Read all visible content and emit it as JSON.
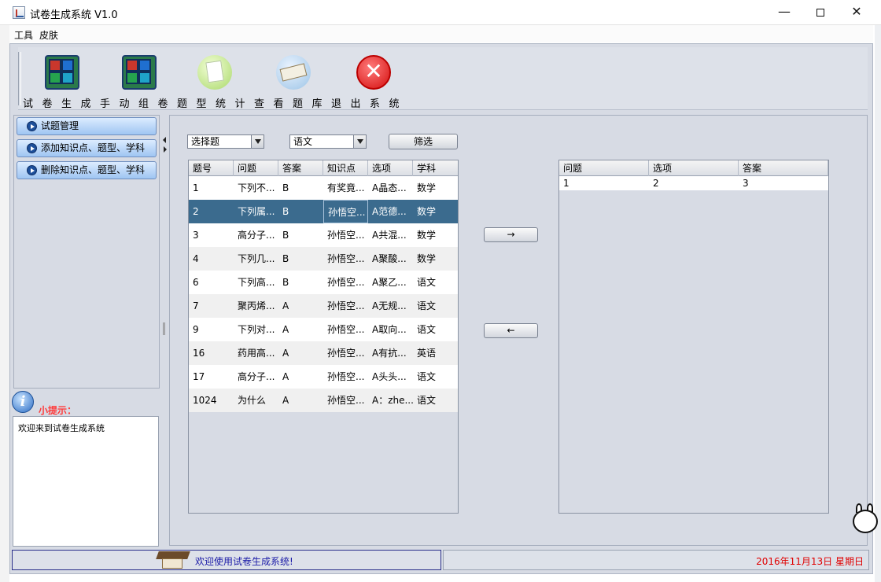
{
  "window": {
    "title": "试卷生成系统 V1.0",
    "minimize": "—",
    "close": "✕"
  },
  "menu": [
    "工具",
    "皮肤"
  ],
  "toolbar": {
    "labels": "试卷生成手动组卷题型统计查看题库退出系统",
    "buttons": [
      {
        "label": "试卷生成",
        "icon": "grid-icon"
      },
      {
        "label": "手动组卷",
        "icon": "grid-icon"
      },
      {
        "label": "题型统计",
        "icon": "note-icon"
      },
      {
        "label": "查看题库",
        "icon": "book-icon"
      },
      {
        "label": "退出系统",
        "icon": "exit-icon"
      }
    ]
  },
  "sidebar": {
    "items": [
      "试题管理",
      "添加知识点、题型、学科",
      "删除知识点、题型、学科"
    ]
  },
  "tip": {
    "title": "小提示：",
    "text": "欢迎来到试卷生成系统"
  },
  "filters": {
    "type_value": "选择题",
    "subject_value": "语文",
    "filter_button": "筛选"
  },
  "question_table": {
    "columns": [
      "题号",
      "问题",
      "答案",
      "知识点",
      "选项",
      "学科"
    ],
    "rows": [
      [
        "1",
        "下列不...",
        "B",
        "有奖竟...",
        "A晶态...",
        "数学"
      ],
      [
        "2",
        "下列属...",
        "B",
        "孙悟空...",
        "A范德...",
        "数学"
      ],
      [
        "3",
        "高分子...",
        "B",
        "孙悟空...",
        "A共混...",
        "数学"
      ],
      [
        "4",
        "下列几...",
        "B",
        "孙悟空...",
        "A聚酸...",
        "数学"
      ],
      [
        "6",
        "下列高...",
        "B",
        "孙悟空...",
        "A聚乙...",
        "语文"
      ],
      [
        "7",
        "聚丙烯...",
        "A",
        "孙悟空...",
        "A无规...",
        "语文"
      ],
      [
        "9",
        "下列对...",
        "A",
        "孙悟空...",
        "A取向...",
        "语文"
      ],
      [
        "16",
        "药用高...",
        "A",
        "孙悟空...",
        "A有抗...",
        "英语"
      ],
      [
        "17",
        "高分子...",
        "A",
        "孙悟空...",
        "A头头...",
        "语文"
      ],
      [
        "1024",
        "为什么",
        "A",
        "孙悟空...",
        "A：zhe...",
        "语文"
      ]
    ],
    "selected_row": 1
  },
  "transfer": {
    "add_label": "→",
    "remove_label": "←"
  },
  "selected_table": {
    "columns": [
      "问题",
      "选项",
      "答案"
    ],
    "rows": [
      [
        "1",
        "2",
        "3"
      ]
    ]
  },
  "status": {
    "message": "欢迎使用试卷生成系统!",
    "date": "2016年11月13日 星期日"
  }
}
